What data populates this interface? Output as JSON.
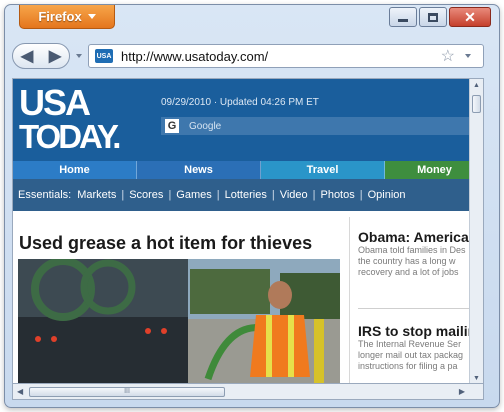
{
  "browser": {
    "menu_button": "Firefox",
    "url": "http://www.usatoday.com/",
    "site_icon_text": "USA"
  },
  "site": {
    "logo_line1": "USA",
    "logo_line2": "TODAY.",
    "dateline": "09/29/2010 · Updated 04:26 PM ET",
    "search_label": "Google",
    "sections": [
      {
        "label": "Home",
        "color": "#2c7cc6"
      },
      {
        "label": "News",
        "color": "#2b6fb6"
      },
      {
        "label": "Travel",
        "color": "#2a95c9"
      },
      {
        "label": "Money",
        "color": "#3e8e3e"
      }
    ],
    "essentials_label": "Essentials:",
    "essentials": [
      "Markets",
      "Scores",
      "Games",
      "Lotteries",
      "Video",
      "Photos",
      "Opinion"
    ]
  },
  "main_story": {
    "headline": "Used grease a hot item for thieves"
  },
  "sidebar": {
    "story1": {
      "headline": "Obama: American",
      "lines": [
        "Obama told families in Des",
        "the country has a long w",
        "recovery and a lot of jobs"
      ]
    },
    "story2": {
      "headline": "IRS to stop mailin",
      "lines": [
        "The Internal Revenue Ser",
        "longer mail out tax packag",
        "instructions for filing a pa"
      ]
    }
  },
  "scrollbar": {
    "hthumb_grip": "III"
  }
}
